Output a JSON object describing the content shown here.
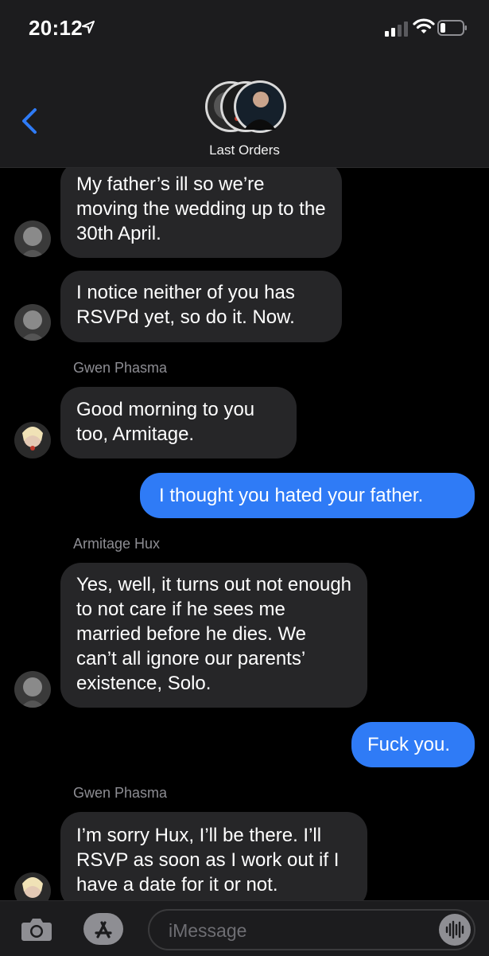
{
  "status": {
    "time": "20:12"
  },
  "header": {
    "title": "Last Orders"
  },
  "messages": [
    {
      "sender": "",
      "text": "My father’s ill so we’re moving the wedding up to the 30th April."
    },
    {
      "sender": "",
      "text": "I notice neither of you has RSVPd yet, so do it. Now."
    },
    {
      "sender": "Gwen Phasma",
      "text": "Good morning to you too, Armitage."
    },
    {
      "sender": "",
      "text": "I thought you hated your father."
    },
    {
      "sender": "Armitage Hux",
      "text": "Yes, well, it turns out not enough to not care if he sees me married before he dies. We can’t all ignore our parents’ existence, Solo."
    },
    {
      "sender": "",
      "text": "Fuck you."
    },
    {
      "sender": "Gwen Phasma",
      "text": "I’m sorry Hux, I’ll be there. I’ll RSVP as soon as I work out if I have a date for it or not."
    }
  ],
  "composer": {
    "placeholder": "iMessage"
  },
  "colors": {
    "outgoing": "#2f7bf6",
    "incoming": "#262628",
    "accent": "#2f7bf6"
  }
}
